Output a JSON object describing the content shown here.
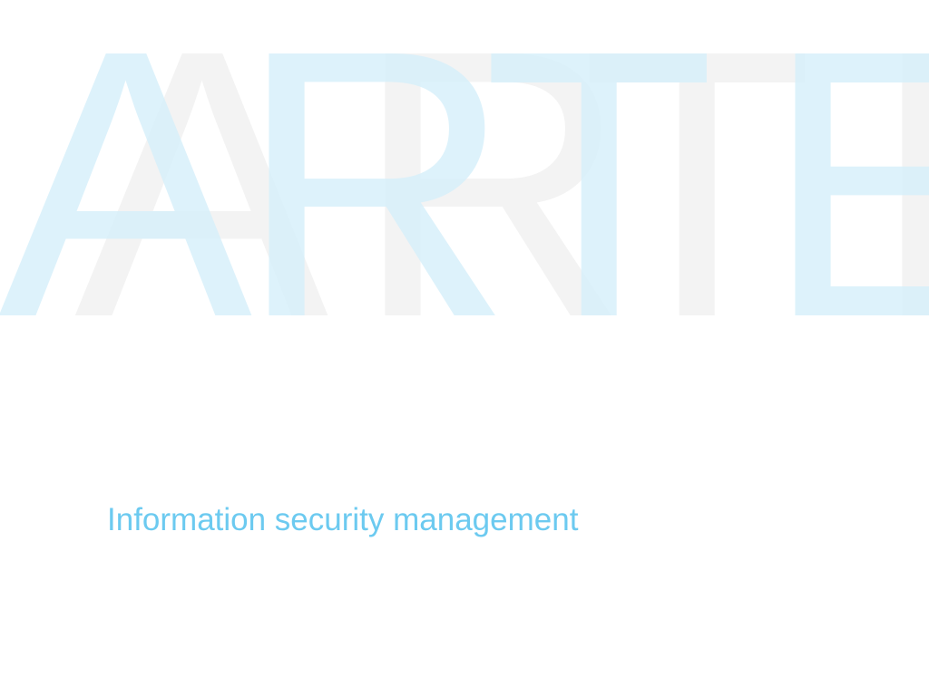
{
  "brand": {
    "wordmark_primary": "ARTE",
    "wordmark_secondary": "ARTE",
    "primary_color": "#d6effa",
    "secondary_color": "#f2f2f2"
  },
  "tagline": {
    "text": "Information security management",
    "color": "#6ccaf0"
  }
}
